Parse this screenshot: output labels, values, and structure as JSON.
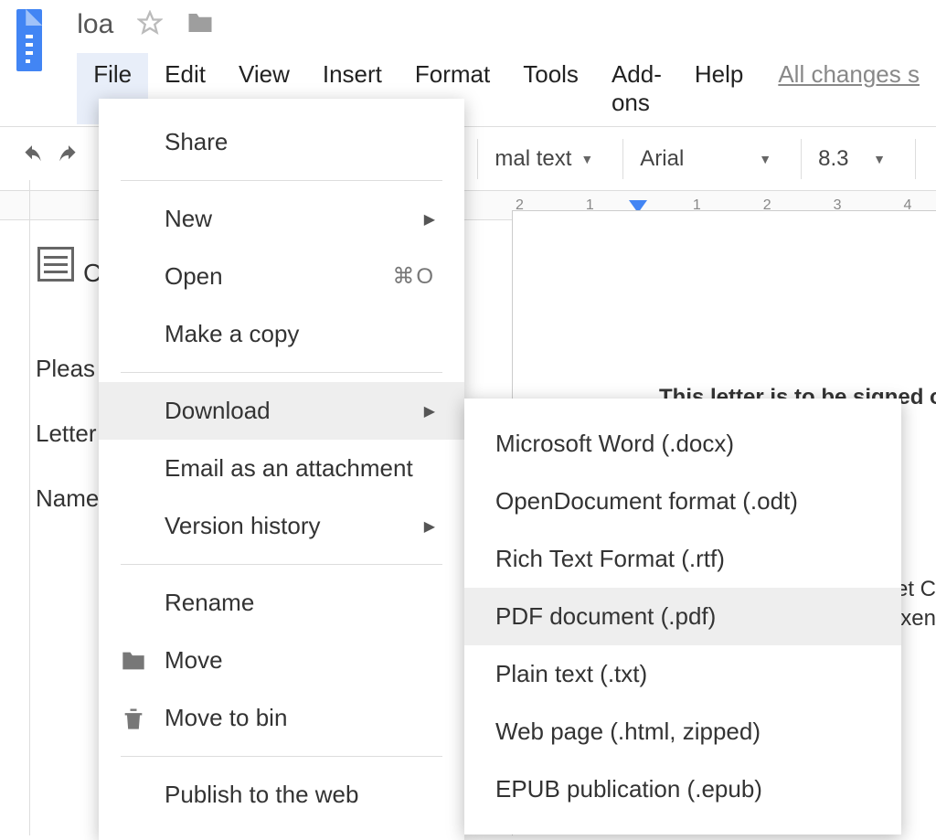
{
  "header": {
    "doc_title": "loa",
    "menus": [
      "File",
      "Edit",
      "View",
      "Insert",
      "Format",
      "Tools",
      "Add-ons",
      "Help"
    ],
    "saved_status": "All changes s"
  },
  "toolbar": {
    "style": "mal text",
    "font": "Arial",
    "size": "8.3"
  },
  "ruler": {
    "ticks": [
      "2",
      "1",
      "1",
      "2",
      "3",
      "4"
    ]
  },
  "outline": {
    "placeholder_letter": "C",
    "items": [
      "Pleas",
      "Letter",
      "Name"
    ]
  },
  "page": {
    "line1": "This letter is to be signed only l",
    "frag1": ".l et C",
    "frag2": "uxen"
  },
  "file_menu": {
    "share": "Share",
    "new": "New",
    "open": "Open",
    "open_shortcut": "⌘O",
    "make_copy": "Make a copy",
    "download": "Download",
    "email_attachment": "Email as an attachment",
    "version_history": "Version history",
    "rename": "Rename",
    "move": "Move",
    "move_to_bin": "Move to bin",
    "publish": "Publish to the web"
  },
  "download_submenu": {
    "docx": "Microsoft Word (.docx)",
    "odt": "OpenDocument format (.odt)",
    "rtf": "Rich Text Format (.rtf)",
    "pdf": "PDF document (.pdf)",
    "txt": "Plain text (.txt)",
    "html": "Web page (.html, zipped)",
    "epub": "EPUB publication (.epub)"
  }
}
